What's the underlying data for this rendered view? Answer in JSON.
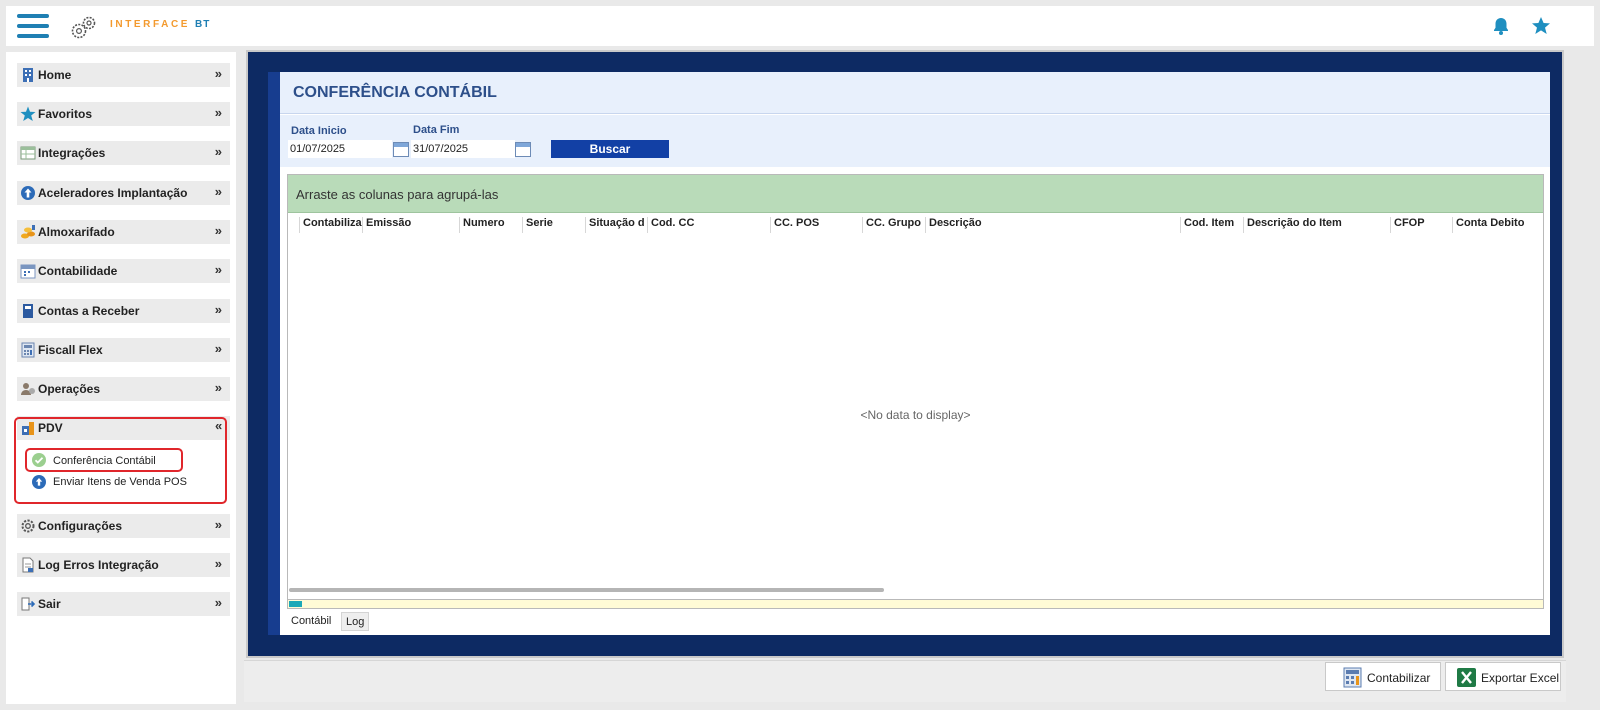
{
  "topbar": {
    "logo_text": "INTERFACE",
    "logo_sub": "BT",
    "icons": [
      "bell-icon",
      "star-icon"
    ],
    "accent_color": "#1f7fb3",
    "brand_color": "#f39a2e"
  },
  "sidebar": {
    "items": [
      {
        "label": "Home",
        "icon": "building-icon"
      },
      {
        "label": "Favoritos",
        "icon": "star-icon"
      },
      {
        "label": "Integrações",
        "icon": "table-icon"
      },
      {
        "label": "Aceleradores Implantação",
        "icon": "arrow-up-circle-icon"
      },
      {
        "label": "Almoxarifado",
        "icon": "coins-icon"
      },
      {
        "label": "Contabilidade",
        "icon": "calendar-icon"
      },
      {
        "label": "Contas a Receber",
        "icon": "book-icon"
      },
      {
        "label": "Fiscall Flex",
        "icon": "calculator-icon"
      },
      {
        "label": "Operações",
        "icon": "users-icon"
      },
      {
        "label": "PDV",
        "icon": "store-icon",
        "expanded": true
      },
      {
        "label": "Configurações",
        "icon": "gear-icon"
      },
      {
        "label": "Log Erros Integração",
        "icon": "document-icon"
      },
      {
        "label": "Sair",
        "icon": "exit-icon"
      }
    ],
    "pdv_subitems": [
      {
        "label": "Conferência Contábil",
        "icon": "check-circle-icon",
        "active": true
      },
      {
        "label": "Enviar Itens de Venda POS",
        "icon": "arrow-up-circle-icon"
      }
    ]
  },
  "main": {
    "title": "CONFERÊNCIA CONTÁBIL",
    "filters": {
      "start_label": "Data Inicio",
      "start_value": "01/07/2025",
      "end_label": "Data Fim",
      "end_value": "31/07/2025",
      "search_label": "Buscar"
    },
    "grid": {
      "group_hint": "Arraste as colunas para agrupá-las",
      "columns": [
        "Contabiliza",
        "Emissão",
        "Numero",
        "Serie",
        "Situação d",
        "Cod. CC",
        "CC. POS",
        "CC. Grupo",
        "Descrição",
        "Cod. Item",
        "Descrição do Item",
        "CFOP",
        "Conta Debito"
      ],
      "empty_text": "<No data to display>"
    },
    "tabs": [
      "Contábil",
      "Log"
    ],
    "progress_fraction": 0.01
  },
  "actions": {
    "contabilizar_label": "Contabilizar",
    "exportar_label": "Exportar Excel"
  }
}
